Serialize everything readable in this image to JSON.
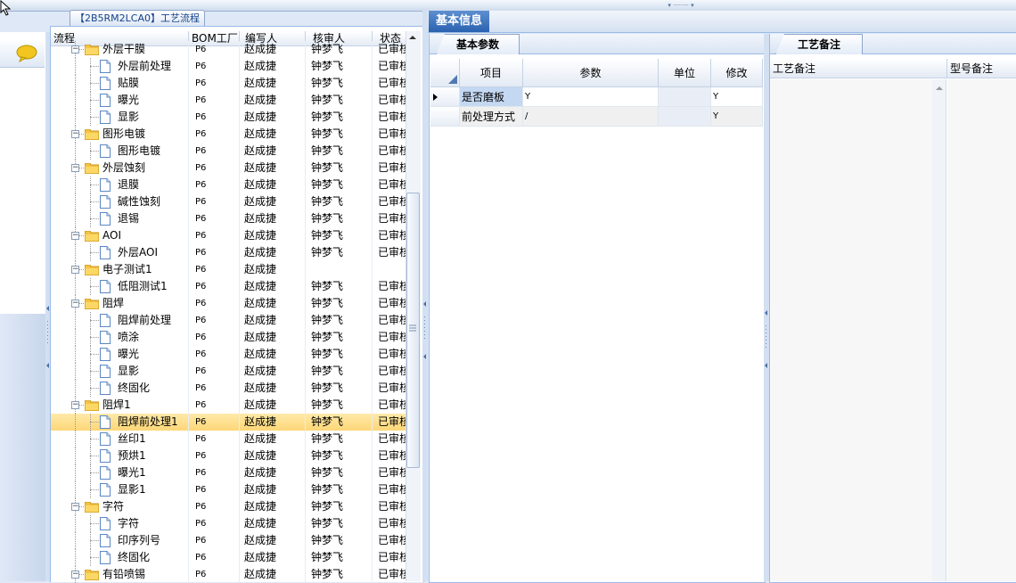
{
  "tree_panel": {
    "tab_title": "【2B5RM2LCA0】工艺流程",
    "columns": [
      "流程",
      "BOM工厂",
      "编写人",
      "核审人",
      "状态"
    ],
    "rows": [
      {
        "name": "外层干膜",
        "kind": "folder",
        "bom": "P6",
        "author": "赵成捷",
        "reviewer": "钟梦飞",
        "status": "已审核"
      },
      {
        "name": "外层前处理",
        "kind": "doc",
        "bom": "P6",
        "author": "赵成捷",
        "reviewer": "钟梦飞",
        "status": "已审核"
      },
      {
        "name": "贴膜",
        "kind": "doc",
        "bom": "P6",
        "author": "赵成捷",
        "reviewer": "钟梦飞",
        "status": "已审核"
      },
      {
        "name": "曝光",
        "kind": "doc",
        "bom": "P6",
        "author": "赵成捷",
        "reviewer": "钟梦飞",
        "status": "已审核"
      },
      {
        "name": "显影",
        "kind": "doc",
        "bom": "P6",
        "author": "赵成捷",
        "reviewer": "钟梦飞",
        "status": "已审核"
      },
      {
        "name": "图形电镀",
        "kind": "folder",
        "bom": "P6",
        "author": "赵成捷",
        "reviewer": "钟梦飞",
        "status": "已审核"
      },
      {
        "name": "图形电镀",
        "kind": "doc",
        "bom": "P6",
        "author": "赵成捷",
        "reviewer": "钟梦飞",
        "status": "已审核"
      },
      {
        "name": "外层蚀刻",
        "kind": "folder",
        "bom": "P6",
        "author": "赵成捷",
        "reviewer": "钟梦飞",
        "status": "已审核"
      },
      {
        "name": "退膜",
        "kind": "doc",
        "bom": "P6",
        "author": "赵成捷",
        "reviewer": "钟梦飞",
        "status": "已审核"
      },
      {
        "name": "碱性蚀刻",
        "kind": "doc",
        "bom": "P6",
        "author": "赵成捷",
        "reviewer": "钟梦飞",
        "status": "已审核"
      },
      {
        "name": "退锡",
        "kind": "doc",
        "bom": "P6",
        "author": "赵成捷",
        "reviewer": "钟梦飞",
        "status": "已审核"
      },
      {
        "name": "AOI",
        "kind": "folder",
        "bom": "P6",
        "author": "赵成捷",
        "reviewer": "钟梦飞",
        "status": "已审核"
      },
      {
        "name": "外层AOI",
        "kind": "doc",
        "bom": "P6",
        "author": "赵成捷",
        "reviewer": "钟梦飞",
        "status": "已审核"
      },
      {
        "name": "电子测试1",
        "kind": "folder",
        "bom": "P6",
        "author": "赵成捷",
        "reviewer": "",
        "status": ""
      },
      {
        "name": "低阻测试1",
        "kind": "doc",
        "bom": "P6",
        "author": "赵成捷",
        "reviewer": "钟梦飞",
        "status": "已审核"
      },
      {
        "name": "阻焊",
        "kind": "folder",
        "bom": "P6",
        "author": "赵成捷",
        "reviewer": "钟梦飞",
        "status": "已审核"
      },
      {
        "name": "阻焊前处理",
        "kind": "doc",
        "bom": "P6",
        "author": "赵成捷",
        "reviewer": "钟梦飞",
        "status": "已审核"
      },
      {
        "name": "喷涂",
        "kind": "doc",
        "bom": "P6",
        "author": "赵成捷",
        "reviewer": "钟梦飞",
        "status": "已审核"
      },
      {
        "name": "曝光",
        "kind": "doc",
        "bom": "P6",
        "author": "赵成捷",
        "reviewer": "钟梦飞",
        "status": "已审核"
      },
      {
        "name": "显影",
        "kind": "doc",
        "bom": "P6",
        "author": "赵成捷",
        "reviewer": "钟梦飞",
        "status": "已审核"
      },
      {
        "name": "终固化",
        "kind": "doc",
        "bom": "P6",
        "author": "赵成捷",
        "reviewer": "钟梦飞",
        "status": "已审核"
      },
      {
        "name": "阻焊1",
        "kind": "folder",
        "bom": "P6",
        "author": "赵成捷",
        "reviewer": "钟梦飞",
        "status": "已审核"
      },
      {
        "name": "阻焊前处理1",
        "kind": "doc",
        "bom": "P6",
        "author": "赵成捷",
        "reviewer": "钟梦飞",
        "status": "已审核",
        "selected": true
      },
      {
        "name": "丝印1",
        "kind": "doc",
        "bom": "P6",
        "author": "赵成捷",
        "reviewer": "钟梦飞",
        "status": "已审核"
      },
      {
        "name": "预烘1",
        "kind": "doc",
        "bom": "P6",
        "author": "赵成捷",
        "reviewer": "钟梦飞",
        "status": "已审核"
      },
      {
        "name": "曝光1",
        "kind": "doc",
        "bom": "P6",
        "author": "赵成捷",
        "reviewer": "钟梦飞",
        "status": "已审核"
      },
      {
        "name": "显影1",
        "kind": "doc",
        "bom": "P6",
        "author": "赵成捷",
        "reviewer": "钟梦飞",
        "status": "已审核"
      },
      {
        "name": "字符",
        "kind": "folder",
        "bom": "P6",
        "author": "赵成捷",
        "reviewer": "钟梦飞",
        "status": "已审核"
      },
      {
        "name": "字符",
        "kind": "doc",
        "bom": "P6",
        "author": "赵成捷",
        "reviewer": "钟梦飞",
        "status": "已审核"
      },
      {
        "name": "印序列号",
        "kind": "doc",
        "bom": "P6",
        "author": "赵成捷",
        "reviewer": "钟梦飞",
        "status": "已审核"
      },
      {
        "name": "终固化",
        "kind": "doc",
        "bom": "P6",
        "author": "赵成捷",
        "reviewer": "钟梦飞",
        "status": "已审核"
      },
      {
        "name": "有铅喷锡",
        "kind": "folder",
        "bom": "P6",
        "author": "赵成捷",
        "reviewer": "钟梦飞",
        "status": "已审核"
      }
    ]
  },
  "main": {
    "tab_title": "基本信息",
    "params_tab": "基本参数",
    "params_columns": [
      "项目",
      "参数",
      "单位",
      "修改"
    ],
    "params_rows": [
      {
        "item": "是否磨板",
        "param": "Y",
        "unit": "",
        "modify": "Y"
      },
      {
        "item": "前处理方式",
        "param": "/",
        "unit": "",
        "modify": "Y"
      }
    ],
    "remark_tab": "工艺备注",
    "remark_columns": [
      "工艺备注",
      "型号备注"
    ]
  },
  "colors": {
    "accent": "#2a62b0",
    "selection": "#fdd778",
    "border": "#99bbe8"
  }
}
